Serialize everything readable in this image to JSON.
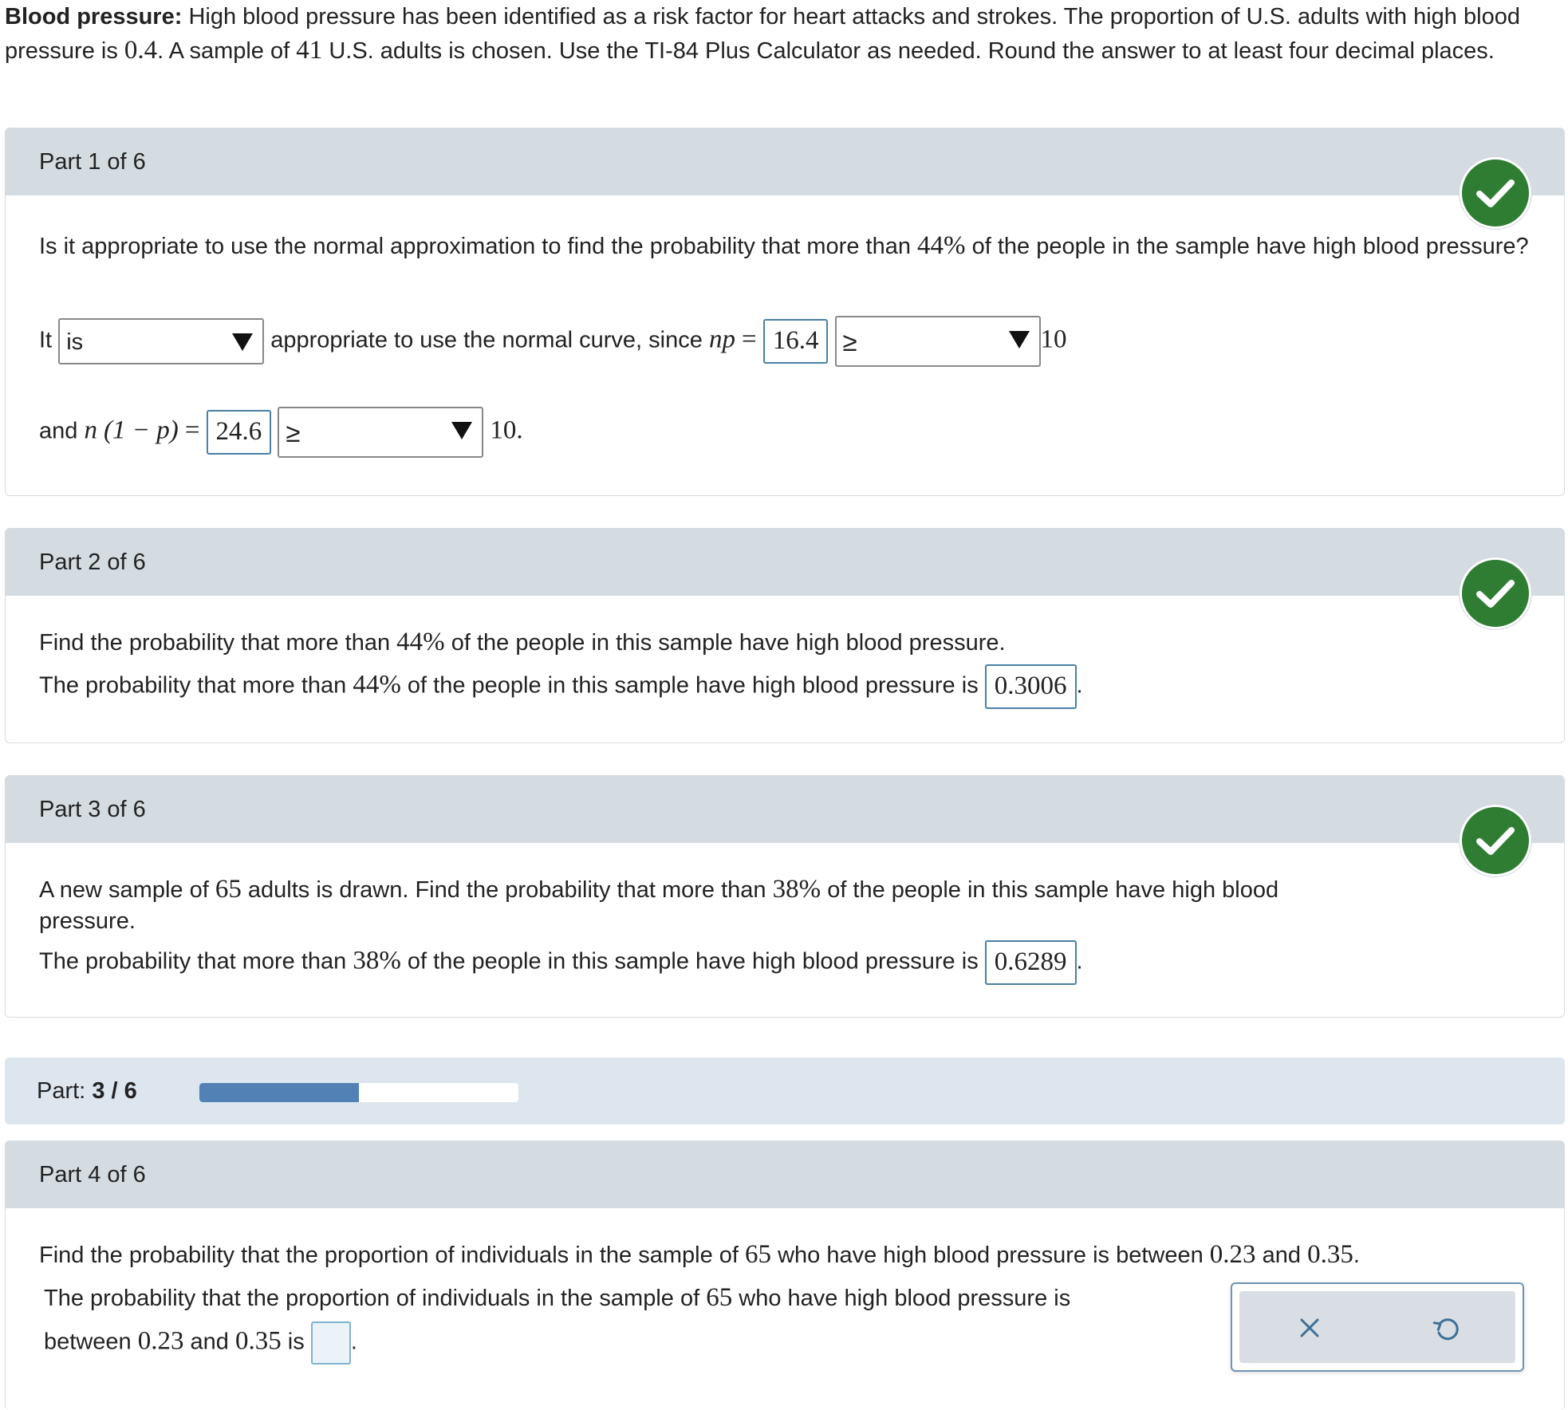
{
  "intro": {
    "label": "Blood pressure:",
    "seg1": "High blood pressure has been identified as a risk factor for heart attacks and strokes. The proportion of U.S. adults with high blood pressure is",
    "p": "0.4",
    "seg2": ". A sample of",
    "n": "41",
    "seg3": "U.S. adults is chosen. Use the TI-84 Plus Calculator as needed. Round the answer to at least four decimal places."
  },
  "part1": {
    "title": "Part 1 of 6",
    "q1": "Is it appropriate to use the normal approximation to find the probability that more than",
    "q_pct": "44%",
    "q2": "of the people in the sample have high blood pressure?",
    "it": "It",
    "select1": "is",
    "mid": "appropriate to use the normal curve, since",
    "np_var": "np",
    "eq": "=",
    "np_val": "16.4",
    "select2": "≥",
    "ten1": "10",
    "and": "and",
    "n_var": "n",
    "one_minus_p": "(1 − p)",
    "nq_val": "24.6",
    "select3": "≥",
    "ten2": "10."
  },
  "part2": {
    "title": "Part 2 of 6",
    "q1": "Find the probability that more than",
    "pct": "44%",
    "q2": "of the people in this sample have high blood pressure.",
    "a1": "The probability that more than",
    "a2": "of the people in this sample have high blood pressure is",
    "answer": "0.3006",
    "period": "."
  },
  "part3": {
    "title": "Part 3 of 6",
    "q1": "A new sample of",
    "n": "65",
    "q2": "adults is drawn. Find the probability that more than",
    "pct": "38%",
    "q3": "of the people in this sample have high blood",
    "q4": "pressure.",
    "a1": "The probability that more than",
    "a2": "of the people in this sample have high blood pressure is",
    "answer": "0.6289",
    "period": "."
  },
  "progress": {
    "label": "Part:",
    "value": "3 / 6",
    "fraction": 0.5
  },
  "part4": {
    "title": "Part 4 of 6",
    "q1": "Find the probability that the proportion of individuals in the sample of",
    "n": "65",
    "q2": "who have high blood pressure is between",
    "lo": "0.23",
    "and": "and",
    "hi": "0.35",
    "period": ".",
    "a1": "The probability that the proportion of individuals in the sample of",
    "a2": "who have high blood pressure is",
    "a3": "between",
    "a4": "is"
  },
  "colors": {
    "check_green": "#2e7d32",
    "header_gray": "#d5dce1",
    "progress_fill": "#5282b5",
    "answer_border": "#4a7fa6"
  },
  "icons": {
    "check": "check-icon",
    "clear": "close-icon",
    "undo": "undo-icon"
  }
}
